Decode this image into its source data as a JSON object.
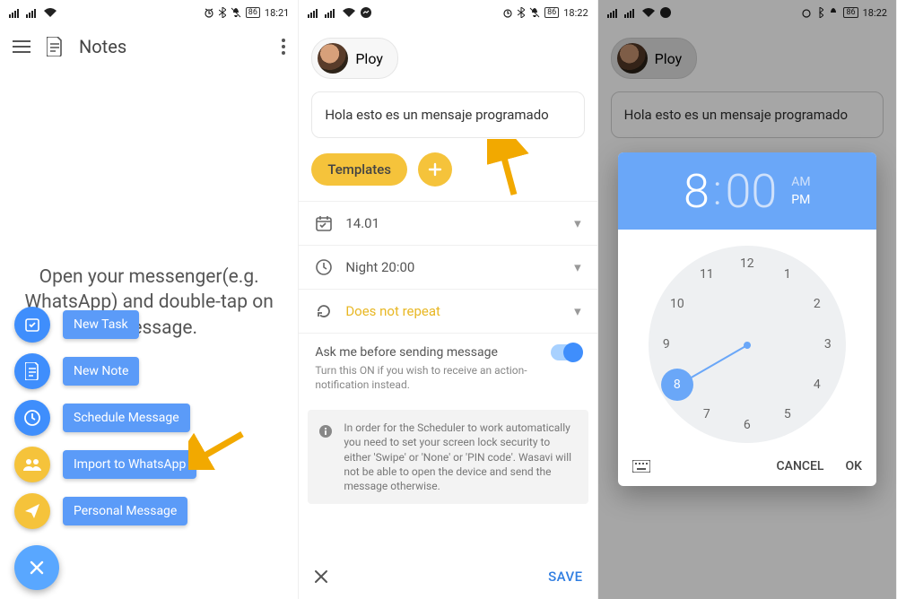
{
  "statusbar": {
    "battery": "86",
    "time1": "18:21",
    "time2": "18:22",
    "time3": "18:22"
  },
  "screen1": {
    "title": "Notes",
    "hint": "Open your messenger(e.g. WhatsApp) and double-tap on a message.",
    "fab": [
      {
        "label": "New Task"
      },
      {
        "label": "New Note"
      },
      {
        "label": "Schedule Message"
      },
      {
        "label": "Import to WhatsApp"
      },
      {
        "label": "Personal Message"
      }
    ]
  },
  "screen2": {
    "contact": "Ploy",
    "message": "Hola esto es un mensaje programado",
    "templates_label": "Templates",
    "date": "14.01",
    "time": "Night 20:00",
    "repeat": "Does not repeat",
    "ask_label": "Ask me before sending message",
    "ask_sub": "Turn this ON if you wish to receive an action-notification instead.",
    "info": "In order for the Scheduler to work automatically you need to set your screen lock security to either 'Swipe' or 'None' or 'PIN code'. Wasavi will not be able to open the device and send the message otherwise.",
    "save": "SAVE"
  },
  "timepicker": {
    "hour": "8",
    "minute": "00",
    "am": "AM",
    "pm": "PM",
    "selected_hour": 8,
    "numbers": [
      "12",
      "1",
      "2",
      "3",
      "4",
      "5",
      "6",
      "7",
      "8",
      "9",
      "10",
      "11"
    ],
    "cancel": "CANCEL",
    "ok": "OK"
  }
}
